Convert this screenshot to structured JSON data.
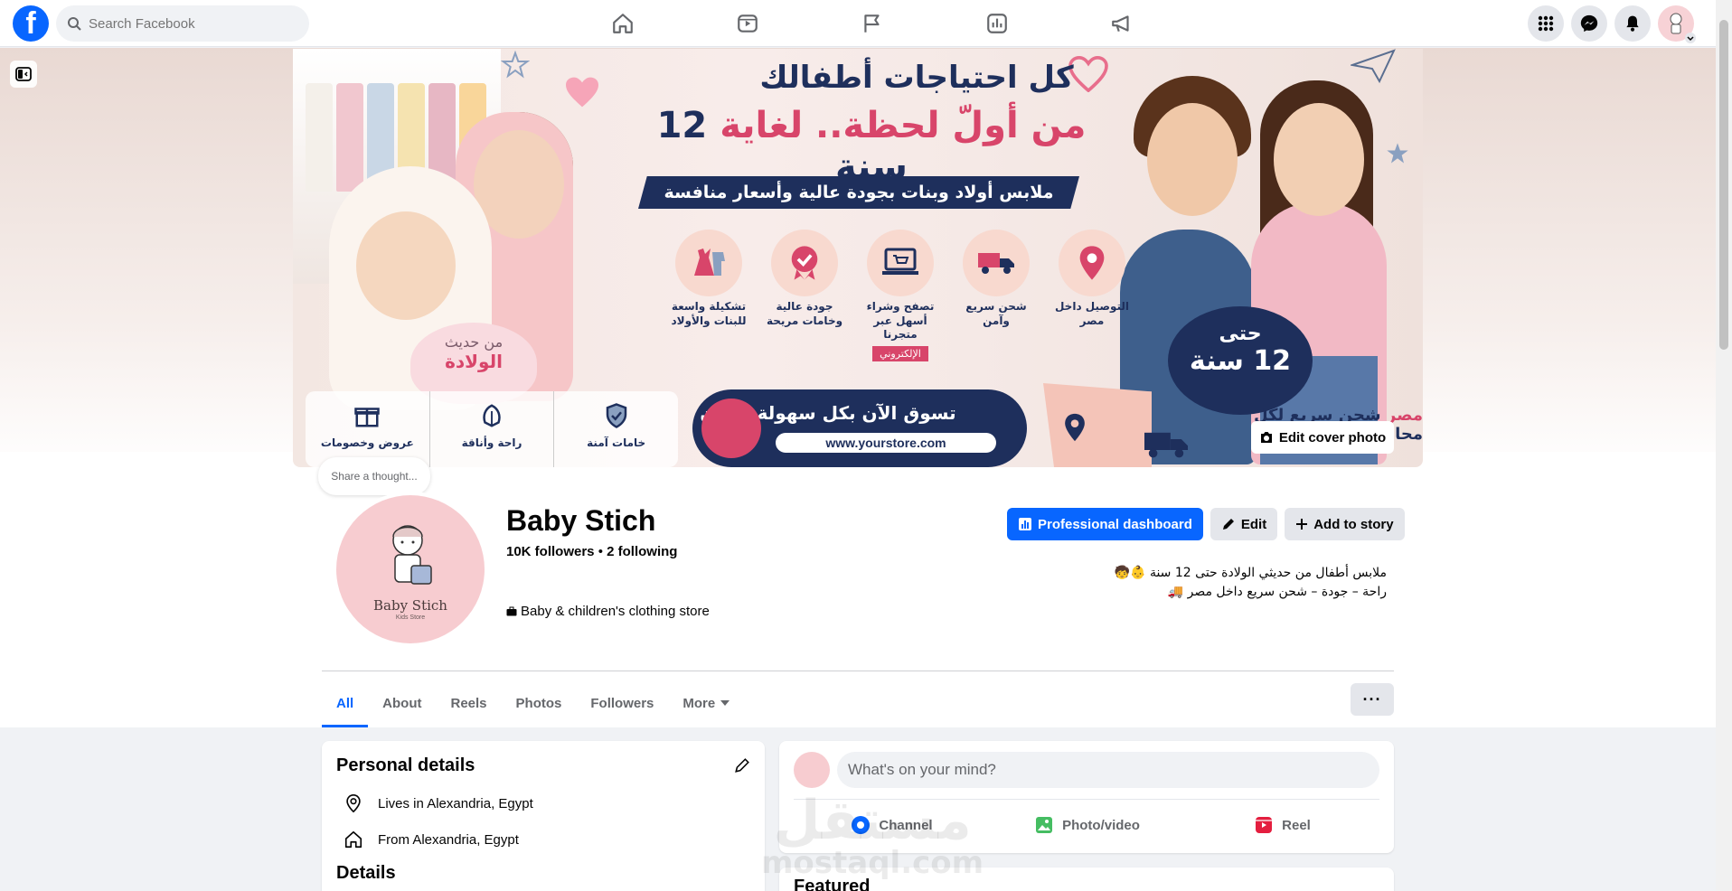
{
  "topbar": {
    "logo": "f",
    "search_placeholder": "Search Facebook",
    "nav_icons": [
      "home-icon",
      "video-icon",
      "flag-icon",
      "chart-icon",
      "megaphone-icon"
    ],
    "right_icons": [
      "apps-grid-icon",
      "messenger-icon",
      "bell-icon",
      "account-avatar"
    ]
  },
  "cover": {
    "headline_line1": "كل احتياجات أطفالك",
    "headline_line2_a": "من أولّ لحظة.. لغاية",
    "headline_line2_b": "12 سنة",
    "banner": "ملابس أولاد وبنات بجودة عالية وأسعار منافسة",
    "features": [
      {
        "icon": "location-icon",
        "text": "التوصيل داخل مصر"
      },
      {
        "icon": "truck-icon",
        "text": "شحن سريع وآمن"
      },
      {
        "icon": "laptop-cart-icon",
        "text": "تصفح وشراء أسهل عبر متجرنا",
        "tag": "الإلكتروني"
      },
      {
        "icon": "badge-icon",
        "text": "جودة عالية وخامات مريحة"
      },
      {
        "icon": "dress-icon",
        "text": "تشكيلة واسعة للبنات والأولاد"
      }
    ],
    "newborn_a": "من حديث",
    "newborn_b": "الولادة",
    "age_a": "حتى",
    "age_b": "12 سنة",
    "strip": [
      {
        "icon": "shield-check-icon",
        "text": "خامات آمنة"
      },
      {
        "icon": "leaf-icon",
        "text": "راحة وأناقة"
      },
      {
        "icon": "gift-icon",
        "text": "عروض وخصومات"
      }
    ],
    "shop_text": "تسوق الآن بكل سهولة وأمان",
    "shop_url": "www.yourstore.com",
    "shipping_a": "شحن سريع لكل محافظات",
    "shipping_b": "مصر",
    "edit_cover_label": "Edit cover photo"
  },
  "profile": {
    "thought_placeholder": "Share a thought...",
    "logo_name": "Baby Stich",
    "logo_sub": "Kids Store",
    "name": "Baby Stich",
    "followers": "10K followers",
    "separator": " • ",
    "following": "2 following",
    "category": "Baby & children's clothing store",
    "bio_line1": "ملابس أطفال من حديثي الولادة حتى 12 سنة 👶🧒",
    "bio_line2": "راحة – جودة – شحن سريع داخل مصر 🚚"
  },
  "actions": {
    "dashboard": "Professional dashboard",
    "edit": "Edit",
    "add_story": "Add to story"
  },
  "tabs": {
    "items": [
      "All",
      "About",
      "Reels",
      "Photos",
      "Followers",
      "More"
    ],
    "active": "All",
    "more_menu": "···"
  },
  "personal_details": {
    "title": "Personal details",
    "rows": [
      {
        "icon": "location-pin-icon",
        "text": "Lives in Alexandria, Egypt"
      },
      {
        "icon": "home-outline-icon",
        "text": "From Alexandria, Egypt"
      }
    ],
    "next_title": "Details"
  },
  "composer": {
    "placeholder": "What's on your mind?",
    "actions": [
      {
        "icon": "channel-icon",
        "label": "Channel",
        "color": "#0866ff"
      },
      {
        "icon": "photo-video-icon",
        "label": "Photo/video",
        "color": "#45bd62"
      },
      {
        "icon": "reel-icon",
        "label": "Reel",
        "color": "#e41e3f"
      }
    ]
  },
  "featured": {
    "title": "Featured"
  },
  "watermark": {
    "line1": "مستقل",
    "line2": "mostaql.com"
  },
  "colors": {
    "brand": "#0866ff",
    "navy": "#1e2f5c",
    "pink": "#d8456a"
  }
}
